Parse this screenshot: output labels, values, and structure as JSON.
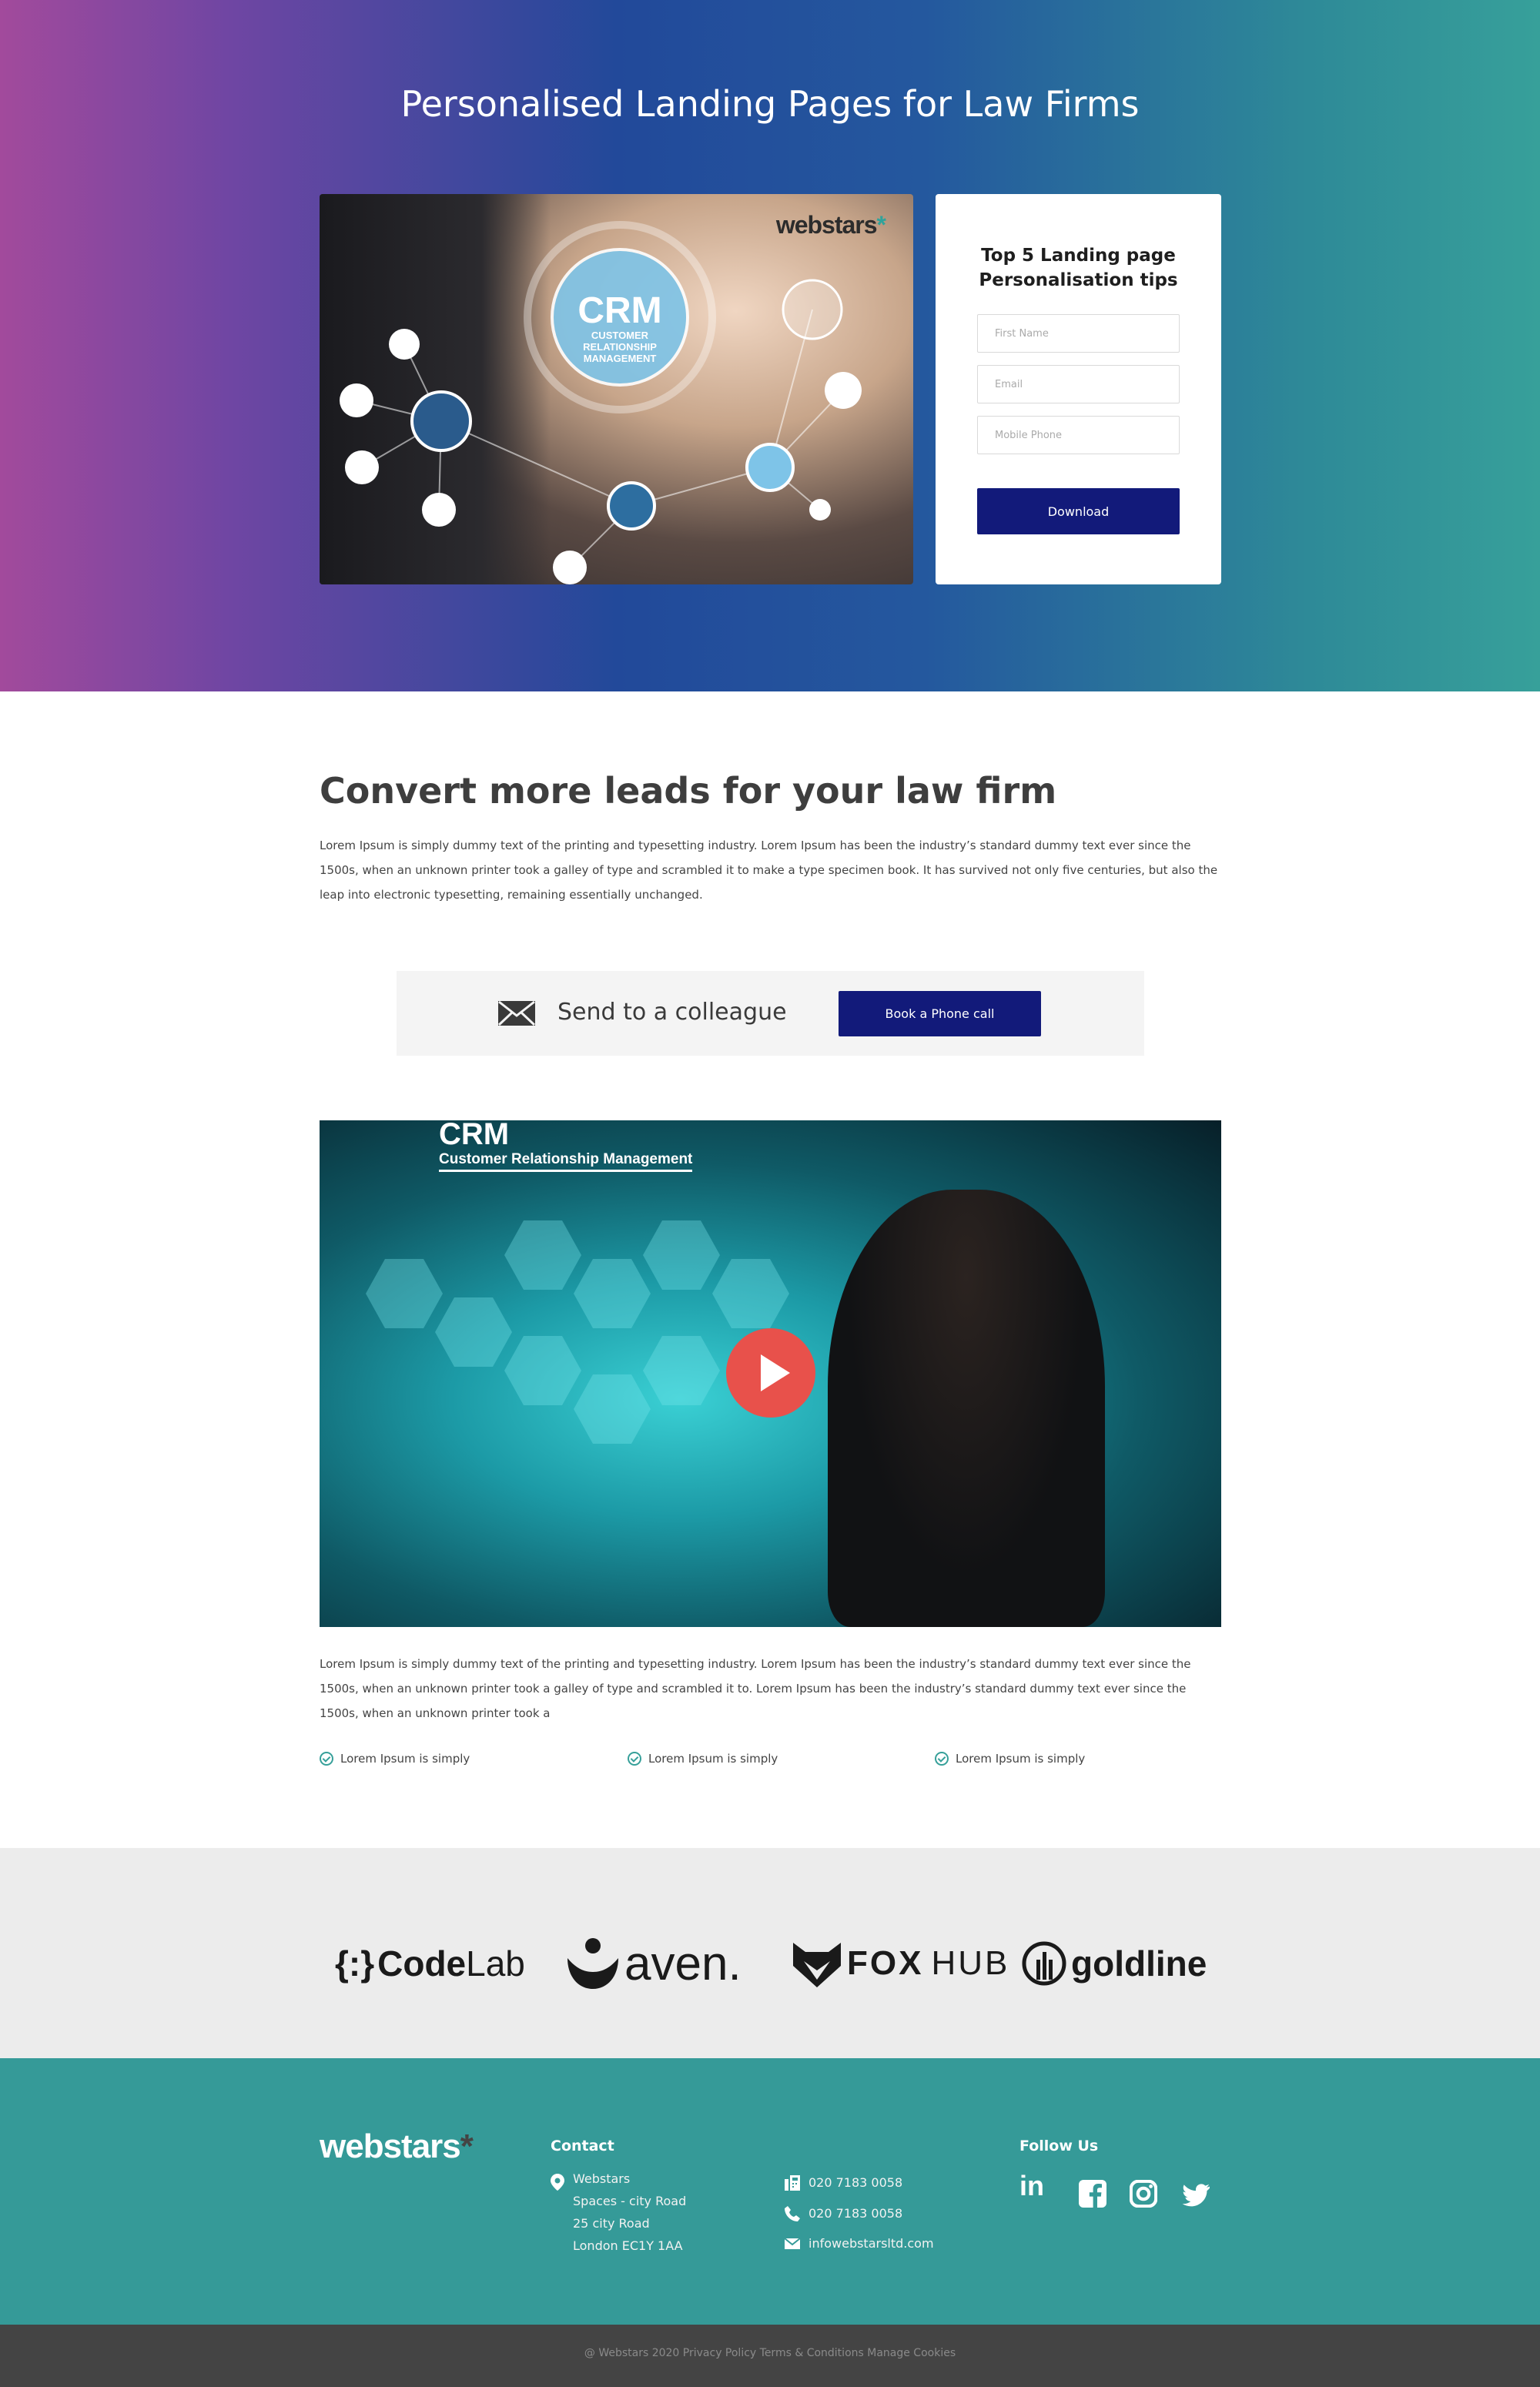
{
  "hero": {
    "title": "Personalised Landing Pages for Law Firms",
    "image_brand": "webstars",
    "image_brand_asterisk": "*",
    "image_text": {
      "crm": "CRM",
      "line1": "CUSTOMER",
      "line2": "RELATIONSHIP",
      "line3": "MANAGEMENT"
    }
  },
  "form": {
    "title": "Top 5 Landing page Personalisation tips",
    "first_name_placeholder": "First Name",
    "email_placeholder": "Email",
    "mobile_placeholder": "Mobile Phone",
    "download_label": "Download"
  },
  "content": {
    "heading": "Convert more leads for your law firm",
    "paragraph1": "Lorem Ipsum is simply dummy text of the printing and typesetting industry. Lorem Ipsum has been the industry’s standard dummy text ever since the 1500s, when an unknown printer took a galley of type and scrambled it to make a type specimen book. It has survived not only five centuries, but also the leap into electronic typesetting, remaining essentially unchanged.",
    "share_label": "Send to a colleague",
    "book_label": "Book a Phone call",
    "video_title": "CRM",
    "video_subtitle": "Customer Relationship Management",
    "paragraph2": "Lorem Ipsum is simply dummy text of the printing and typesetting industry. Lorem Ipsum has been the industry’s standard dummy text ever since the 1500s, when an unknown printer took a galley of type and scrambled it to. Lorem Ipsum has been the industry’s standard dummy text ever since the 1500s, when an unknown printer took a",
    "checks": [
      "Lorem Ipsum is simply",
      "Lorem Ipsum is simply",
      "Lorem Ipsum is simply"
    ]
  },
  "logos": {
    "codelab_brace": "{:}",
    "codelab_bold": "Code",
    "codelab_thin": "Lab",
    "aven": "aven.",
    "fox_bold": "FOX",
    "fox_thin": "HUB",
    "goldline": "goldline"
  },
  "footer": {
    "brand": "webstars",
    "brand_asterisk": "*",
    "contact_heading": "Contact",
    "address": [
      "Webstars",
      "Spaces - city Road",
      "25 city Road",
      "London EC1Y 1AA"
    ],
    "fax": "020 7183 0058",
    "phone": "020 7183 0058",
    "email": "infowebstarsltd.com",
    "follow_heading": "Follow Us",
    "social": {
      "linkedin": "in",
      "facebook": "f"
    }
  },
  "bottom": {
    "copyright": "@ Webstars 2020 Privacy Policy Terms & Conditions Manage Cookies"
  },
  "colors": {
    "brand_navy": "#121a7a",
    "teal": "#359a98",
    "play_red": "#e8514b",
    "hero_gradient": [
      "#a24a9c",
      "#22499a",
      "#37a09a"
    ]
  },
  "icons": [
    "envelope-icon",
    "play-icon",
    "check-circle-icon",
    "location-pin-icon",
    "fax-icon",
    "phone-icon",
    "mail-icon",
    "linkedin-icon",
    "facebook-icon",
    "instagram-icon",
    "twitter-icon"
  ]
}
